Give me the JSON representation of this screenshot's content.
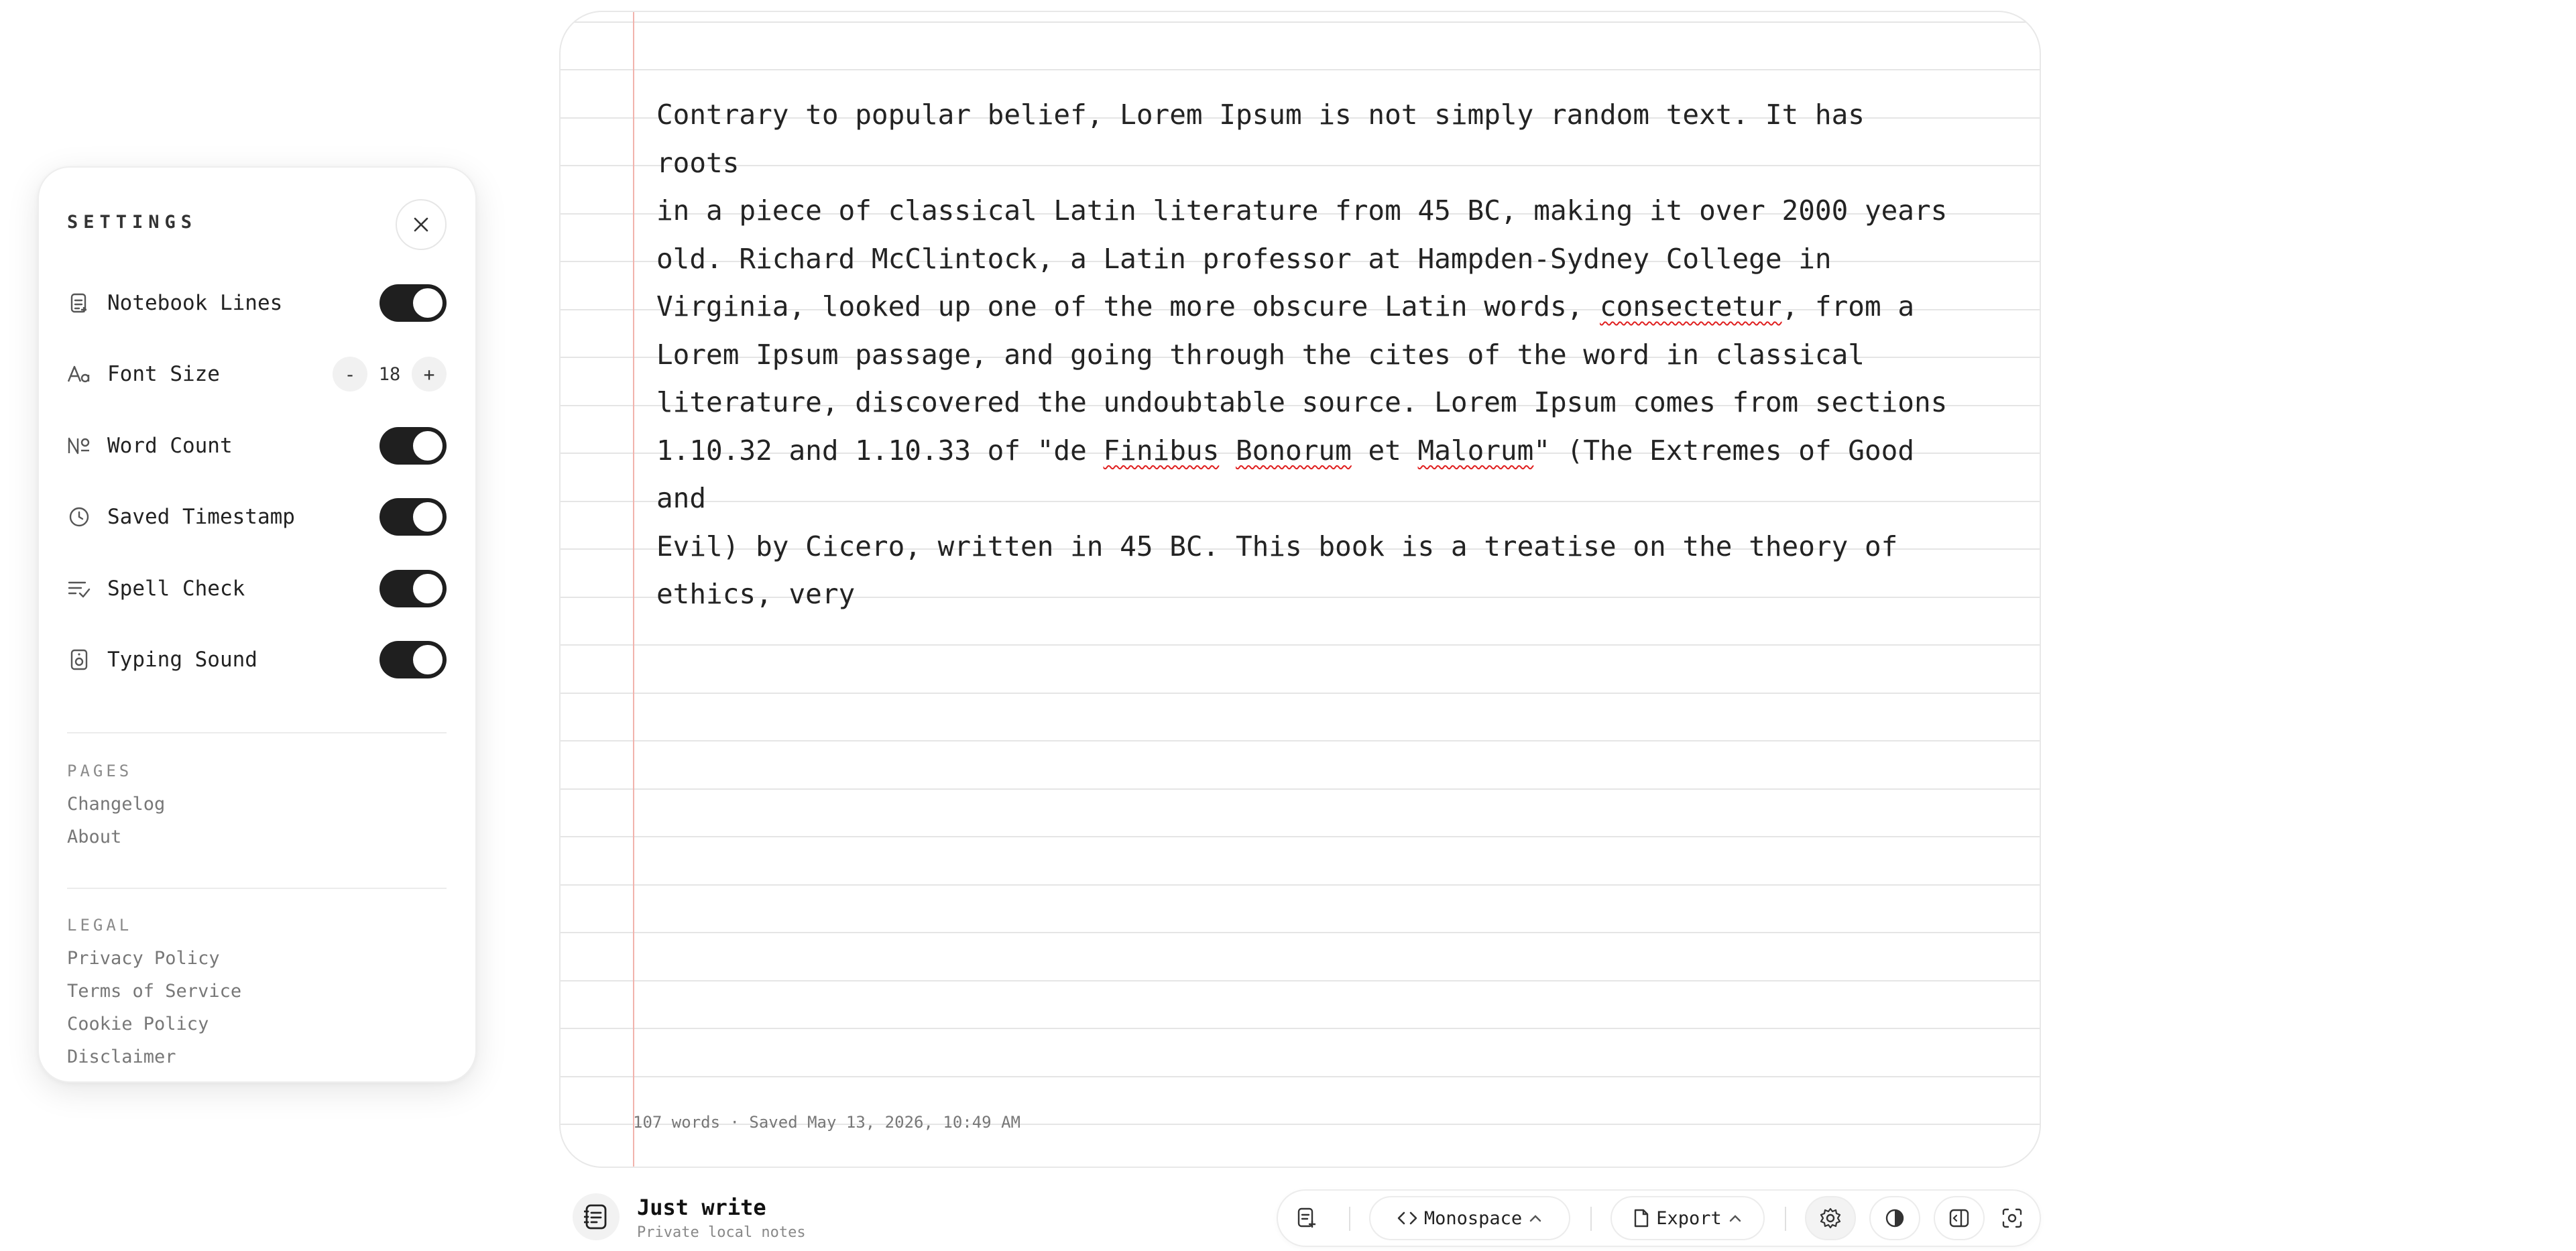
{
  "settings": {
    "title": "SETTINGS",
    "rows": [
      {
        "label": "Notebook Lines",
        "icon": "notebook-lines-icon",
        "type": "toggle",
        "on": true
      },
      {
        "label": "Font Size",
        "icon": "font-size-icon",
        "type": "stepper"
      },
      {
        "label": "Word Count",
        "icon": "numero-icon",
        "type": "toggle",
        "on": true
      },
      {
        "label": "Saved Timestamp",
        "icon": "clock-icon",
        "type": "toggle",
        "on": true
      },
      {
        "label": "Spell Check",
        "icon": "spell-check-icon",
        "type": "toggle",
        "on": true
      },
      {
        "label": "Typing Sound",
        "icon": "speaker-icon",
        "type": "toggle",
        "on": true
      }
    ],
    "font_size": {
      "decrement": "-",
      "value": "18",
      "increment": "+"
    },
    "pages": {
      "title": "PAGES",
      "links": [
        "Changelog",
        "About"
      ]
    },
    "legal": {
      "title": "LEGAL",
      "links": [
        "Privacy Policy",
        "Terms of Service",
        "Cookie Policy",
        "Disclaimer"
      ]
    }
  },
  "editor": {
    "segments": [
      "Contrary to popular belief, Lorem Ipsum is not simply random text. It has roots\nin a piece of classical Latin literature from 45 BC, making it over 2000 years\nold. Richard McClintock, a Latin professor at Hampden-Sydney College in\nVirginia, looked up one of the more obscure Latin words, ",
      "consectetur",
      ", from a\nLorem Ipsum passage, and going through the cites of the word in classical\nliterature, discovered the undoubtable source. Lorem Ipsum comes from sections\n1.10.32 and 1.10.33 of \"de ",
      "Finibus",
      " ",
      "Bonorum",
      " et ",
      "Malorum",
      "\" (The Extremes of Good and\nEvil) by Cicero, written in 45 BC. This book is a treatise on the theory of\nethics, very"
    ],
    "misspelled": [
      "consectetur",
      "Finibus",
      "Bonorum",
      "Malorum"
    ],
    "status": "107 words · Saved May 13, 2026, 10:49 AM"
  },
  "app": {
    "name": "Just write",
    "subtitle": "Private local notes"
  },
  "toolbar": {
    "font_label": "Monospace",
    "export_label": "Export"
  },
  "colors": {
    "margin_line": "#f1b3ad",
    "toggle_on": "#1f1f1f",
    "spell_error": "#e02020"
  }
}
